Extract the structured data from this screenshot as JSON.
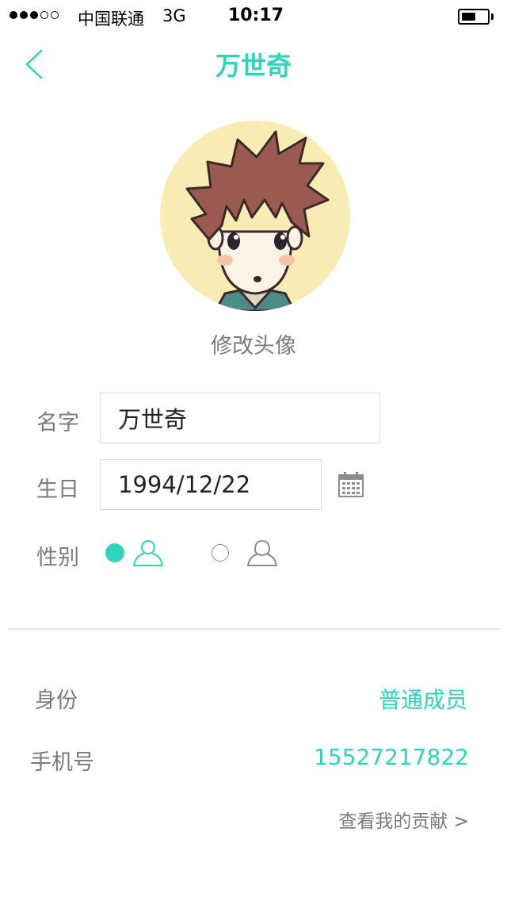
{
  "status_bar": {
    "carrier": "中国联通",
    "network": "3G",
    "time": "10:17",
    "signal_bars": 3,
    "signal_total": 5,
    "battery_level": 0.55
  },
  "nav": {
    "title": "万世奇",
    "back_icon": "chevron-left-icon"
  },
  "avatar": {
    "change_label": "修改头像"
  },
  "form": {
    "name_label": "名字",
    "name_value": "万世奇",
    "birthday_label": "生日",
    "birthday_value": "1994/12/22",
    "calendar_icon": "calendar-icon",
    "gender_label": "性别",
    "gender_selected": "male",
    "male_icon": "male-person-icon",
    "female_icon": "female-person-icon"
  },
  "info": {
    "identity_label": "身份",
    "identity_value": "普通成员",
    "phone_label": "手机号",
    "phone_value": "15527217822",
    "contribution_link": "查看我的贡献 >"
  },
  "colors": {
    "accent": "#2fd3b9",
    "muted_text": "#7a7a7a",
    "border": "#dcdcdc"
  }
}
